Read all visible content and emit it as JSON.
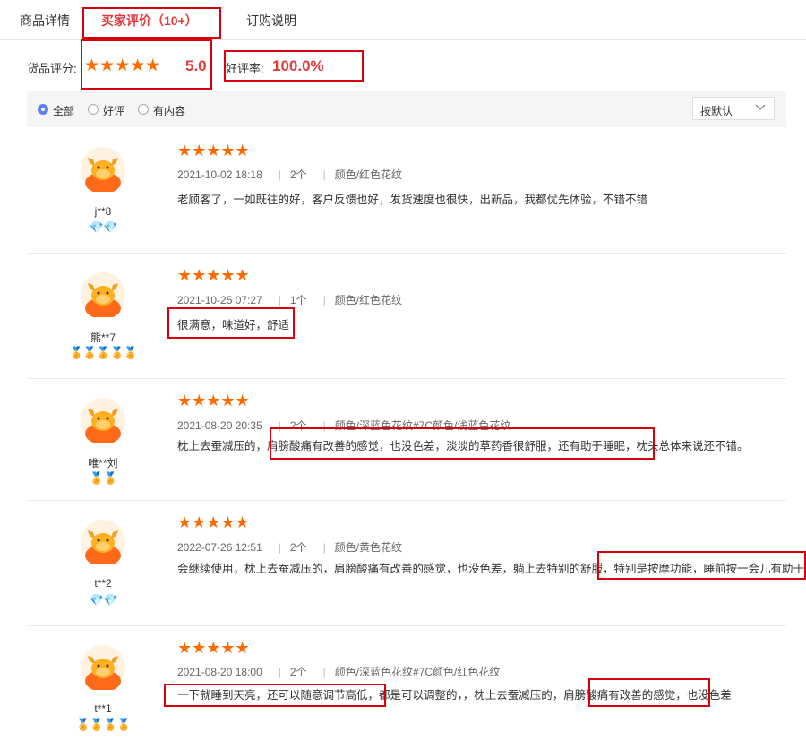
{
  "tabs": [
    {
      "label": "商品详情"
    },
    {
      "label": "买家评价（10+）",
      "active": true
    },
    {
      "label": "订购说明"
    }
  ],
  "summary": {
    "score_label": "货品评分:",
    "score_stars": "★★★★★",
    "score_value": "5.0",
    "good_rate_label": "好评率:",
    "good_rate_value": "100.0%"
  },
  "filters": {
    "options": [
      {
        "label": "全部",
        "selected": true
      },
      {
        "label": "好评",
        "selected": false
      },
      {
        "label": "有内容",
        "selected": false
      }
    ],
    "sort_label": "按默认"
  },
  "colors": {
    "accent": "#e4393c",
    "star": "#ff6a00",
    "highlight_box": "#d6000f",
    "radio": "#5a84f0"
  },
  "reviews": [
    {
      "user": "j**8",
      "badges": "💎💎",
      "stars": "★★★★★",
      "date": "2021-10-02 18:18",
      "qty": "2个",
      "spec": "颜色/红色花纹",
      "content": "老顾客了，一如既往的好，客户反馈也好，发货速度也很快，出新品，我都优先体验，不错不错"
    },
    {
      "user": "熊**7",
      "badges": "🏅🏅🏅🏅🏅",
      "stars": "★★★★★",
      "date": "2021-10-25 07:27",
      "qty": "1个",
      "spec": "颜色/红色花纹",
      "content": "很满意，味道好，舒适"
    },
    {
      "user": "唯**刘",
      "badges": "🏅🏅",
      "stars": "★★★★★",
      "date": "2021-08-20 20:35",
      "qty": "2个",
      "spec": "颜色/深蓝色花纹#7C颜色/浅蓝色花纹",
      "content": "枕上去蚕减压的，肩膀酸痛有改善的感觉，也没色差，淡淡的草药香很舒服，还有助于睡眠，枕头总体来说还不错。"
    },
    {
      "user": "t**2",
      "badges": "💎💎",
      "stars": "★★★★★",
      "date": "2022-07-26 12:51",
      "qty": "2个",
      "spec": "颜色/黄色花纹",
      "content": "会继续使用，枕上去蚕减压的，肩膀酸痛有改善的感觉，也没色差，躺上去特别的舒服，特别是按摩功能，睡前按一会儿有助于睡眠"
    },
    {
      "user": "t**1",
      "badges": "🏅🏅🏅🏅",
      "stars": "★★★★★",
      "date": "2021-08-20 18:00",
      "qty": "2个",
      "spec": "颜色/深蓝色花纹#7C颜色/红色花纹",
      "content": "一下就睡到天亮，还可以随意调节高低，都是可以调整的，，枕上去蚕减压的，肩膀酸痛有改善的感觉，也没色差"
    }
  ]
}
